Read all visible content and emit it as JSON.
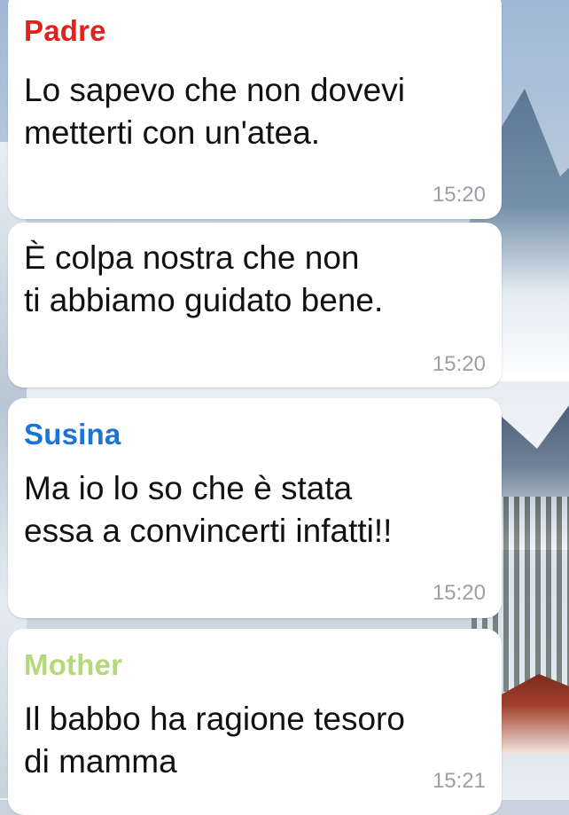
{
  "colors": {
    "padre": "#e0221b",
    "susina": "#1a73d9",
    "mother": "#b6d77a",
    "bubble": "#ffffff",
    "timestamp": "#9aa0a6"
  },
  "messages": [
    {
      "sender": "Padre",
      "text": "Lo sapevo che non dovevi\nmetterti con un'atea.",
      "time": "15:20"
    },
    {
      "sender": "",
      "text": "È colpa nostra che non\nti abbiamo guidato bene.",
      "time": "15:20"
    },
    {
      "sender": "Susina",
      "text": "Ma io lo so che è stata\nessa a convincerti infatti!!",
      "time": "15:20"
    },
    {
      "sender": "Mother",
      "text": "Il babbo ha ragione tesoro\ndi mamma",
      "time": "15:21"
    }
  ]
}
